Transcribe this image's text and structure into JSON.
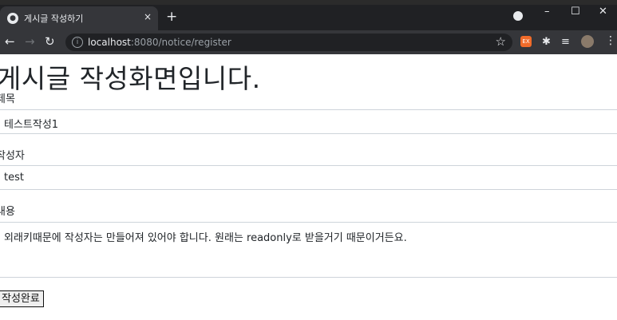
{
  "browser": {
    "tab_title": "게시글 작성하기",
    "tab_close": "×",
    "new_tab": "+",
    "url_host": "localhost",
    "url_path": ":8080/notice/register",
    "ext_label": "EX"
  },
  "page": {
    "heading": "게시글 작성화면입니다.",
    "title_label": "제목",
    "title_value": "테스트작성1",
    "writer_label": "작성자",
    "writer_value": "test",
    "content_label": "내용",
    "content_value": "외래키때문에 작성자는 만들어져 있어야 합니다. 원래는 readonly로 받을거기 때문이거든요.",
    "submit_label": "작성완료"
  }
}
